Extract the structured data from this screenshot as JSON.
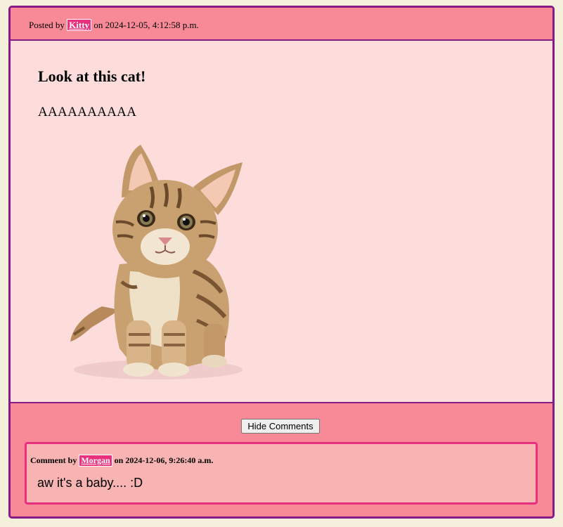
{
  "post": {
    "posted_by_prefix": "Posted by",
    "author": "Kitty",
    "on_word": "on",
    "timestamp": "2024-12-05, 4:12:58 p.m.",
    "title": "Look at this cat!",
    "body": "AAAAAAAAAA",
    "image_subject": "kitten"
  },
  "comments": {
    "hide_button_label": "Hide Comments",
    "items": [
      {
        "prefix": "Comment by",
        "author": "Morgan",
        "on_word": "on",
        "timestamp": "2024-12-06, 9:26:40 a.m.",
        "text": "aw it's a baby.... :D"
      }
    ]
  },
  "colors": {
    "page_background": "#f5f0dc",
    "card_border": "#861a86",
    "header_background": "#f88a98",
    "body_background": "#fddcdc",
    "author_badge": "#e8307e",
    "comment_background": "#f8b3b3"
  }
}
